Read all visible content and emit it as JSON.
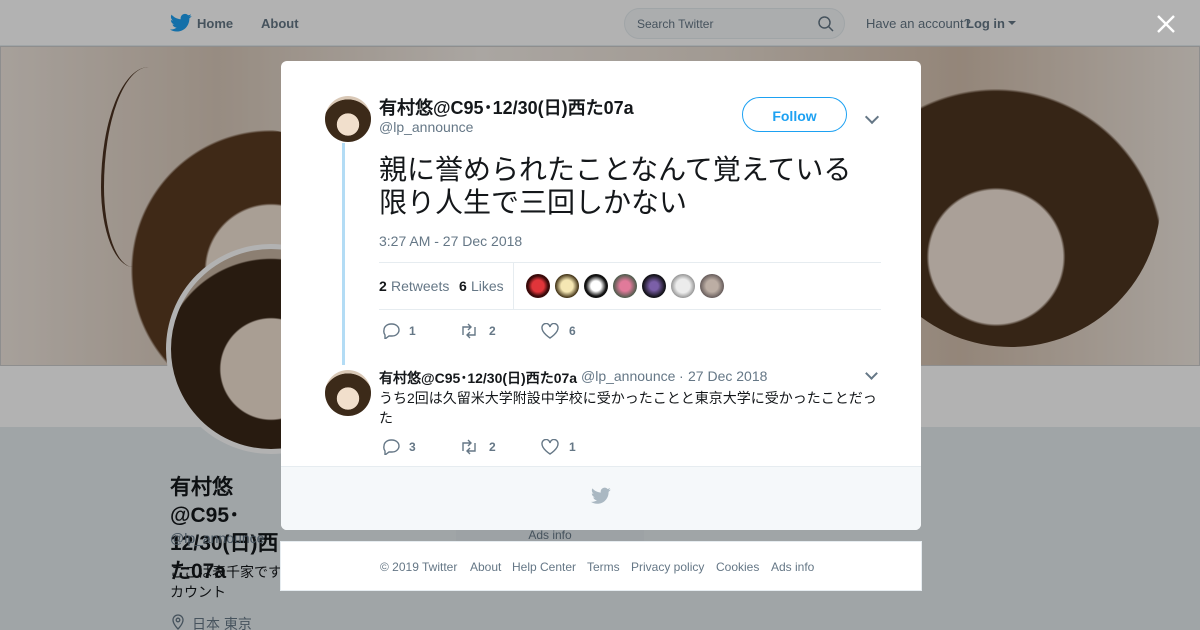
{
  "nav": {
    "home": "Home",
    "about": "About",
    "search_placeholder": "Search Twitter",
    "have_account": "Have an account?",
    "login": "Log in"
  },
  "profile": {
    "name": "有村悠@C95･12/30(日)西た07a",
    "handle": "@lp_announce",
    "bio": "ここは表千家です カウント",
    "location": "日本 東京",
    "ads_info": "Ads info"
  },
  "tweet": {
    "author_name": "有村悠@C95･12/30(日)西た07a",
    "author_handle": "@lp_announce",
    "follow_label": "Follow",
    "text": "親に誉められたことなんて覚えている限り人生で三回しかない",
    "timestamp": "3:27 AM - 27 Dec 2018",
    "retweets_count": "2",
    "retweets_label": "Retweets",
    "likes_count": "6",
    "likes_label": "Likes",
    "actions": {
      "reply": "1",
      "retweet": "2",
      "like": "6"
    }
  },
  "reply": {
    "author_name": "有村悠@C95･12/30(日)西た07a",
    "author_handle": "@lp_announce",
    "separator": "·",
    "date": "27 Dec 2018",
    "text": "うち2回は久留米大学附設中学校に受かったことと東京大学に受かったことだった",
    "actions": {
      "reply": "3",
      "retweet": "2",
      "like": "1"
    }
  },
  "footer": {
    "copyright": "© 2019 Twitter",
    "about": "About",
    "help": "Help Center",
    "terms": "Terms",
    "privacy": "Privacy policy",
    "cookies": "Cookies",
    "ads": "Ads info"
  },
  "colors": {
    "brand": "#1da1f2",
    "thread_line": "#b3dcf5",
    "muted": "#657786"
  },
  "icons": {
    "logo": "twitter-bird-icon",
    "search": "search-icon",
    "close": "close-icon",
    "reply": "reply-icon",
    "retweet": "retweet-icon",
    "like": "heart-icon",
    "location": "location-pin-icon"
  }
}
